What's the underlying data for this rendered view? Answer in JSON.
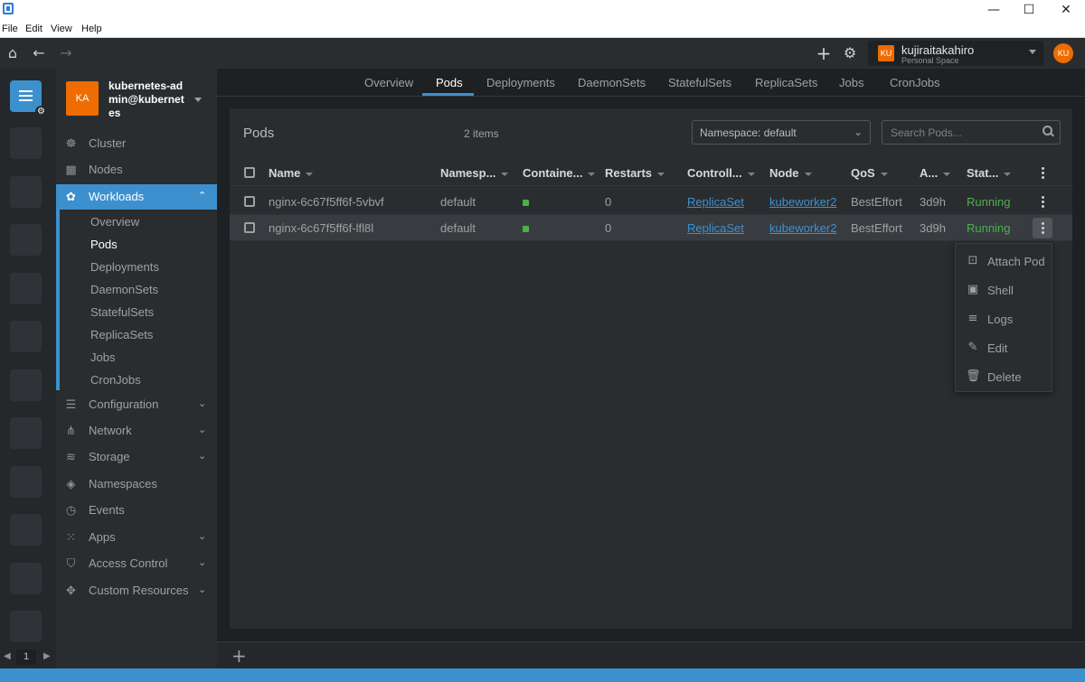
{
  "window": {
    "minimize": "—",
    "maximize": "☐",
    "close": "✕"
  },
  "menubar": [
    "File",
    "Edit",
    "View",
    "Help"
  ],
  "topbar": {
    "home_icon": "⌂",
    "back_icon": "←",
    "forward_icon": "→",
    "add_icon": "+",
    "settings_icon": "⚙",
    "workspace": {
      "avatar": "KU",
      "name": "kujiraitakahiro",
      "subtitle": "Personal Space"
    },
    "user_avatar": "KU"
  },
  "hotbar": {
    "page": "1",
    "prev": "◀",
    "next": "▶"
  },
  "cluster": {
    "avatar": "KA",
    "name": "kubernetes-admin@kubernetes"
  },
  "sidebar": {
    "items": [
      {
        "label": "Cluster",
        "icon": "helm-icon"
      },
      {
        "label": "Nodes",
        "icon": "nodes-icon"
      },
      {
        "label": "Workloads",
        "icon": "workloads-icon",
        "active": true
      },
      {
        "label": "Configuration",
        "icon": "list-icon"
      },
      {
        "label": "Network",
        "icon": "network-icon"
      },
      {
        "label": "Storage",
        "icon": "database-icon"
      },
      {
        "label": "Namespaces",
        "icon": "layers-icon"
      },
      {
        "label": "Events",
        "icon": "clock-icon"
      },
      {
        "label": "Apps",
        "icon": "apps-grid-icon"
      },
      {
        "label": "Access Control",
        "icon": "shield-icon"
      },
      {
        "label": "Custom Resources",
        "icon": "puzzle-icon"
      }
    ],
    "workloads_sub": [
      "Overview",
      "Pods",
      "Deployments",
      "DaemonSets",
      "StatefulSets",
      "ReplicaSets",
      "Jobs",
      "CronJobs"
    ]
  },
  "tabs": [
    "Overview",
    "Pods",
    "Deployments",
    "DaemonSets",
    "StatefulSets",
    "ReplicaSets",
    "Jobs",
    "CronJobs"
  ],
  "panel": {
    "title": "Pods",
    "count": "2 items",
    "namespace_select": "Namespace: default",
    "search_placeholder": "Search Pods..."
  },
  "table": {
    "headers": [
      "Name",
      "Namesp...",
      "Containe...",
      "Restarts",
      "Controll...",
      "Node",
      "QoS",
      "A...",
      "Stat..."
    ],
    "rows": [
      {
        "name": "nginx-6c67f5ff6f-5vbvf",
        "namespace": "default",
        "restarts": "0",
        "controller": "ReplicaSet",
        "node": "kubeworker2",
        "qos": "BestEffort",
        "age": "3d9h",
        "status": "Running"
      },
      {
        "name": "nginx-6c67f5ff6f-lfl8l",
        "namespace": "default",
        "restarts": "0",
        "controller": "ReplicaSet",
        "node": "kubeworker2",
        "qos": "BestEffort",
        "age": "3d9h",
        "status": "Running"
      }
    ]
  },
  "context_menu": [
    {
      "label": "Attach Pod",
      "icon": "attach-icon"
    },
    {
      "label": "Shell",
      "icon": "terminal-icon"
    },
    {
      "label": "Logs",
      "icon": "logs-icon"
    },
    {
      "label": "Edit",
      "icon": "pencil-icon"
    },
    {
      "label": "Delete",
      "icon": "trash-icon"
    }
  ],
  "footer": {
    "add_icon": "+"
  },
  "colors": {
    "accent": "#3d90ce",
    "running": "#4caf50",
    "avatar": "#ef6c00"
  }
}
